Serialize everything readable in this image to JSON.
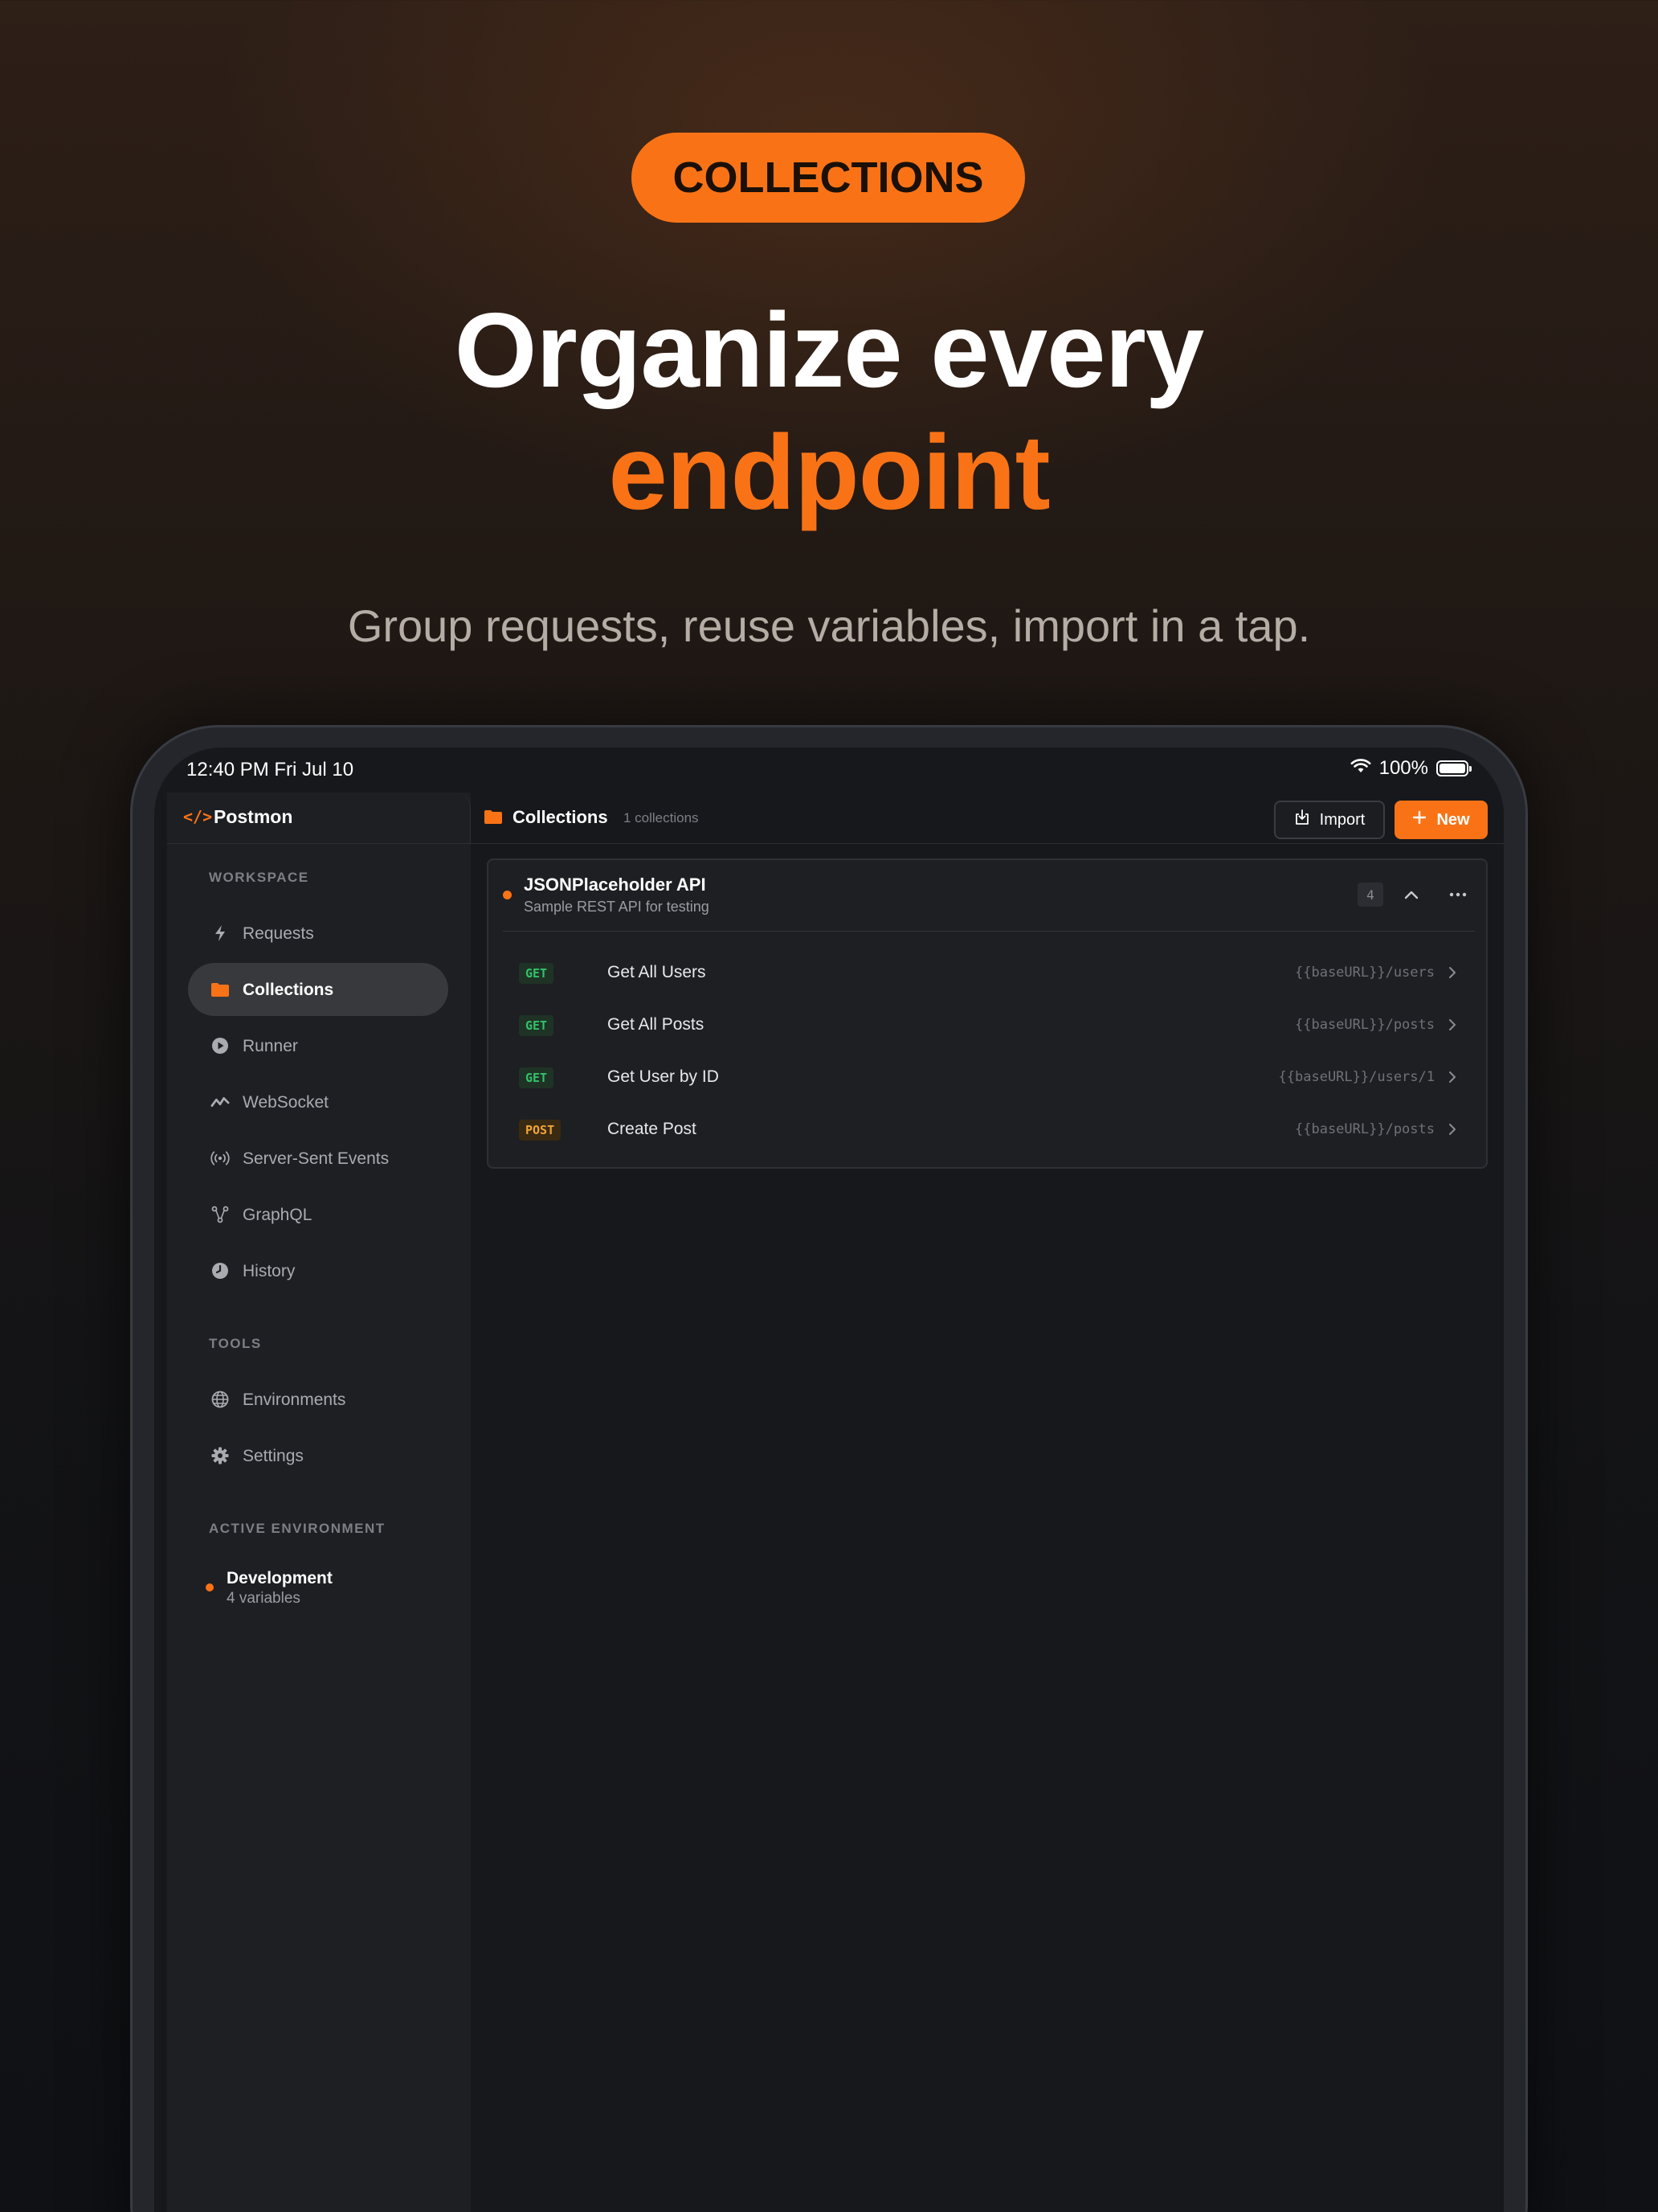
{
  "hero": {
    "badge": "COLLECTIONS",
    "headline_line1": "Organize every",
    "headline_line2": "endpoint",
    "subtitle": "Group requests, reuse variables, import in a tap.",
    "accent_color": "#f97316"
  },
  "status_bar": {
    "time": "12:40 PM   Fri Jul 10",
    "battery": "100%"
  },
  "sidebar": {
    "app_name": "Postmon",
    "workspace_label": "WORKSPACE",
    "workspace_items": [
      {
        "label": "Requests",
        "icon": "bolt-icon"
      },
      {
        "label": "Collections",
        "icon": "folder-icon",
        "active": true
      },
      {
        "label": "Runner",
        "icon": "play-icon"
      },
      {
        "label": "WebSocket",
        "icon": "wave-icon"
      },
      {
        "label": "Server-Sent Events",
        "icon": "broadcast-icon"
      },
      {
        "label": "GraphQL",
        "icon": "graph-icon"
      },
      {
        "label": "History",
        "icon": "clock-icon"
      }
    ],
    "tools_label": "TOOLS",
    "tools_items": [
      {
        "label": "Environments",
        "icon": "globe-icon"
      },
      {
        "label": "Settings",
        "icon": "gear-icon"
      }
    ],
    "active_env_label": "ACTIVE ENVIRONMENT",
    "active_env": {
      "name": "Development",
      "vars": "4 variables"
    }
  },
  "main": {
    "title": "Collections",
    "count": "1 collections",
    "import_label": "Import",
    "new_label": "New",
    "collection": {
      "name": "JSONPlaceholder API",
      "description": "Sample REST API for testing",
      "request_count": "4",
      "requests": [
        {
          "method": "GET",
          "name": "Get All Users",
          "url": "{{baseURL}}/users"
        },
        {
          "method": "GET",
          "name": "Get All Posts",
          "url": "{{baseURL}}/posts"
        },
        {
          "method": "GET",
          "name": "Get User by ID",
          "url": "{{baseURL}}/users/1"
        },
        {
          "method": "POST",
          "name": "Create Post",
          "url": "{{baseURL}}/posts"
        }
      ]
    }
  }
}
